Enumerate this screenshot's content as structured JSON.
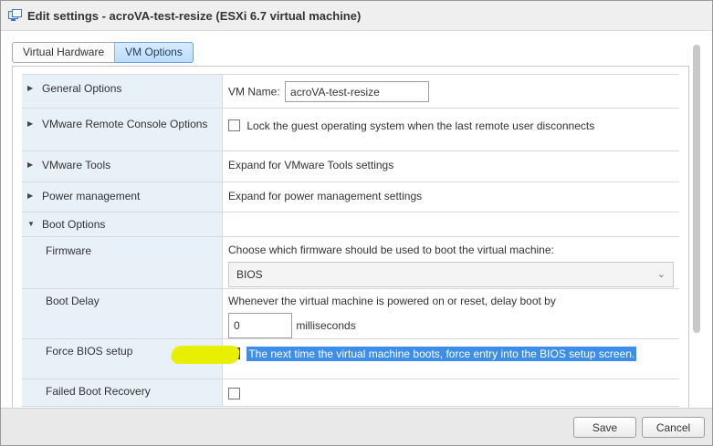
{
  "window": {
    "title": "Edit settings - acroVA-test-resize (ESXi 6.7 virtual machine)"
  },
  "tabs": [
    {
      "label": "Virtual Hardware",
      "active": false
    },
    {
      "label": "VM Options",
      "active": true
    }
  ],
  "sections": {
    "general": {
      "label": "General Options",
      "vm_name_label": "VM Name:",
      "vm_name_value": "acroVA-test-resize"
    },
    "remote_console": {
      "label": "VMware Remote Console Options",
      "checkbox_label": "Lock the guest operating system when the last remote user disconnects",
      "checked": false
    },
    "tools": {
      "label": "VMware Tools",
      "value": "Expand for VMware Tools settings"
    },
    "power": {
      "label": "Power management",
      "value": "Expand for power management settings"
    },
    "boot": {
      "label": "Boot Options",
      "firmware": {
        "label": "Firmware",
        "description": "Choose which firmware should be used to boot the virtual machine:",
        "selected": "BIOS"
      },
      "boot_delay": {
        "label": "Boot Delay",
        "description": "Whenever the virtual machine is powered on or reset, delay boot by",
        "value": "0",
        "unit": "milliseconds"
      },
      "force_bios": {
        "label": "Force BIOS setup",
        "checkbox_label": "The next time the virtual machine boots, force entry into the BIOS setup screen.",
        "checked": true
      },
      "failed_boot": {
        "label": "Failed Boot Recovery"
      }
    }
  },
  "footer": {
    "save_label": "Save",
    "cancel_label": "Cancel"
  },
  "colors": {
    "accent": "#3d8ee8",
    "label_bg": "#e8f0f8",
    "marker": "#e9ef00"
  },
  "icons": {
    "title": "vm-settings-icon",
    "expand": "caret-right-icon",
    "collapse": "caret-down-icon",
    "select": "chevron-down-icon"
  }
}
